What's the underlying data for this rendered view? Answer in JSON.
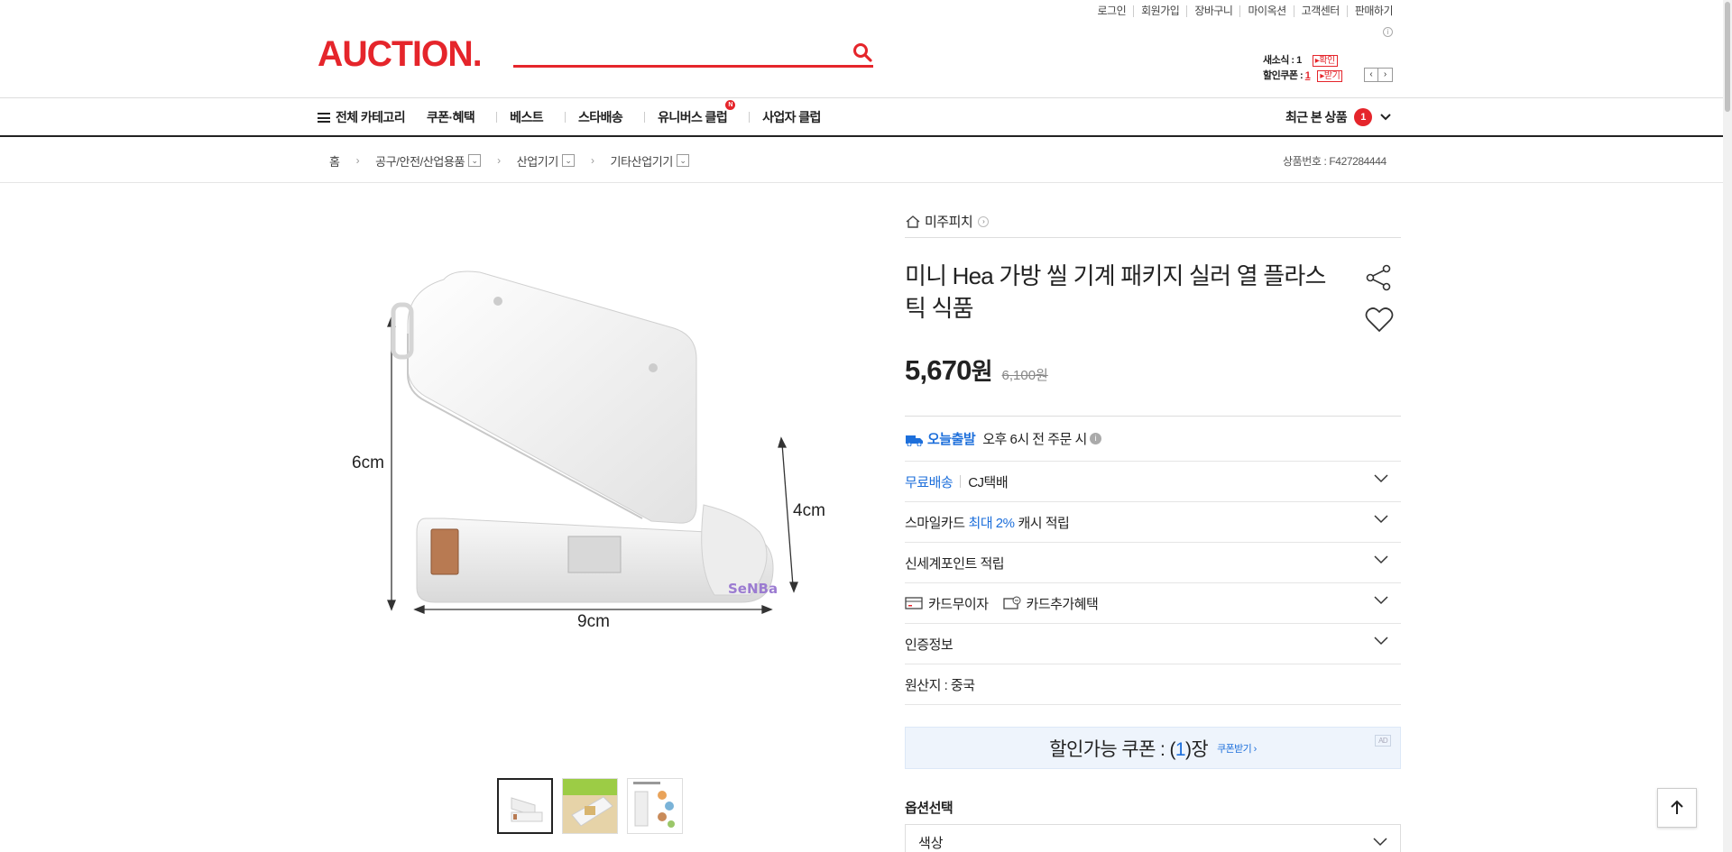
{
  "util_links": [
    "로그인",
    "회원가입",
    "장바구니",
    "마이옥션",
    "고객센터",
    "판매하기"
  ],
  "logo": "AUCTION.",
  "search": {
    "placeholder": ""
  },
  "mini": {
    "new_news_label": "새소식 : ",
    "new_news_count": "1",
    "new_news_btn": "확인",
    "coupon_label": "할인쿠폰 : ",
    "coupon_count": "1",
    "coupon_btn": "받기"
  },
  "nav": {
    "all_category": "전체 카테고리",
    "items": [
      "쿠폰·혜택",
      "베스트",
      "스타배송",
      "유니버스 클럽",
      "사업자 클럽"
    ],
    "new_badge": "N",
    "recent_label": "최근 본 상품",
    "recent_count": "1"
  },
  "breadcrumb": {
    "home": "홈",
    "levels": [
      "공구/안전/산업용품",
      "산업기기",
      "기타산업기기"
    ],
    "product_no": "상품번호 : F427284444"
  },
  "product": {
    "store": "미주피치",
    "title": "미니 Hea 가방 씰 기계 패키지 실러 열 플라스틱 식품",
    "price": "5,670",
    "won": "원",
    "old_price": "6,100원",
    "image_labels": {
      "height": "6cm",
      "depth": "4cm",
      "width": "9cm"
    },
    "watermark": "SeNBa"
  },
  "info": {
    "today_ship": "오늘출발",
    "today_ship_desc": "오후 6시 전 주문 시",
    "free_ship": "무료배송",
    "courier": "CJ택배",
    "smilecard_prefix": "스마일카드 ",
    "smilecard_highlight": "최대 2%",
    "smilecard_suffix": " 캐시 적립",
    "ssg_point": "신세계포인트 적립",
    "card_interest_free": "카드무이자",
    "card_extra": "카드추가혜택",
    "cert": "인증정보",
    "origin": "원산지 : 중국"
  },
  "coupon": {
    "label_prefix": "할인가능 쿠폰 : (",
    "count": "1",
    "label_suffix": ")장",
    "get_btn": "쿠폰받기 ›",
    "ad": "AD"
  },
  "options": {
    "title": "옵션선택",
    "first": "색상"
  },
  "colors": {
    "brand_red": "#e5252b",
    "link_blue": "#1d6fdb"
  }
}
